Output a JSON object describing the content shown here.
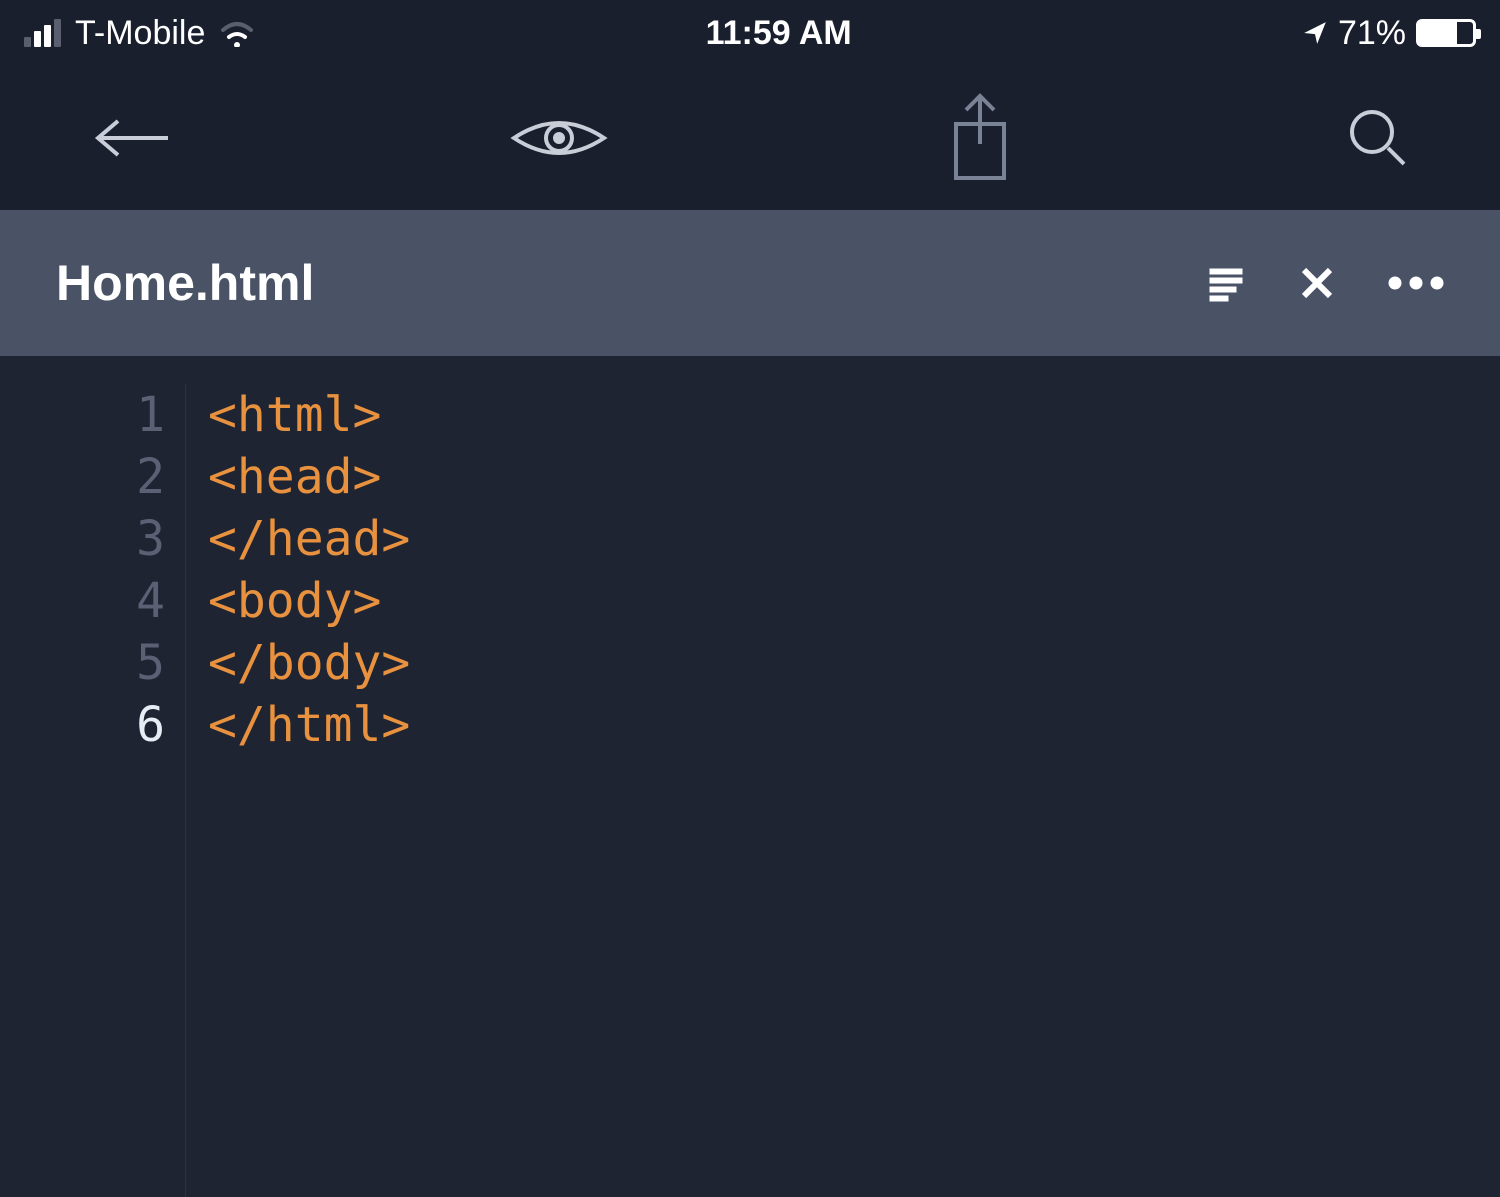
{
  "status": {
    "carrier": "T-Mobile",
    "time": "11:59 AM",
    "battery_pct": "71%"
  },
  "tab": {
    "filename": "Home.html"
  },
  "code": {
    "lines": [
      {
        "num": "1",
        "text": "<html>",
        "active": false
      },
      {
        "num": "2",
        "text": "<head>",
        "active": false
      },
      {
        "num": "3",
        "text": "</head>",
        "active": false
      },
      {
        "num": "4",
        "text": "<body>",
        "active": false
      },
      {
        "num": "5",
        "text": "</body>",
        "active": false
      },
      {
        "num": "6",
        "text": "</html>",
        "active": true
      }
    ]
  }
}
